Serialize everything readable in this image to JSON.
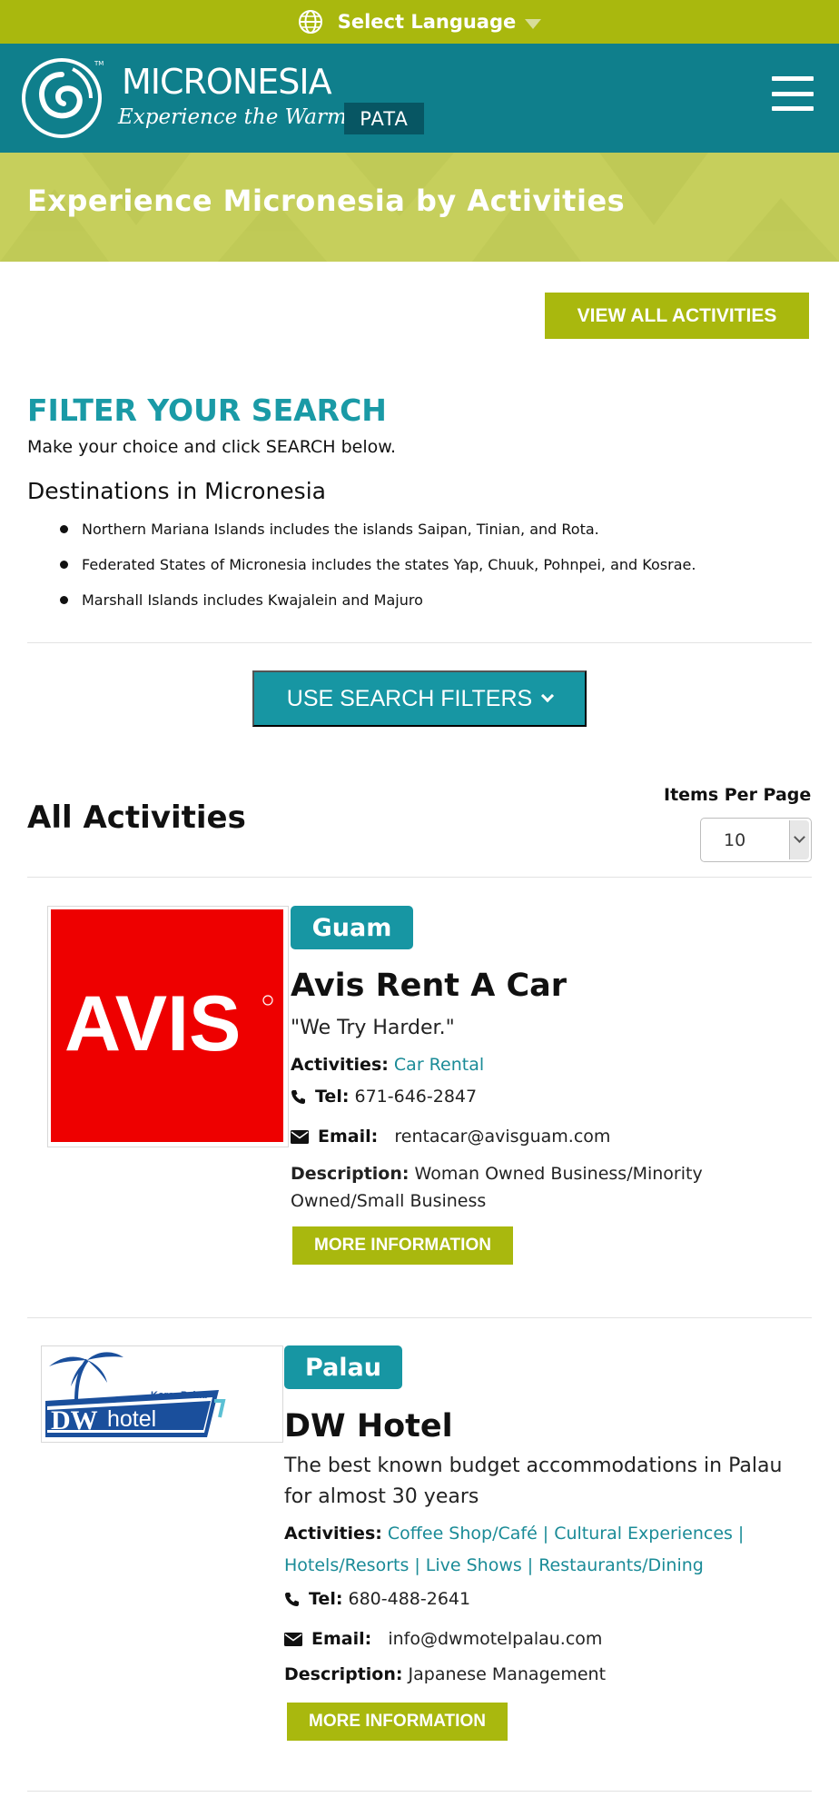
{
  "language_bar": {
    "label": "Select Language"
  },
  "header": {
    "brand": "MICRONESIA",
    "tagline": "Experience the Warmth",
    "partner": "PATA",
    "tm": "TM"
  },
  "banner": {
    "title": "Experience Micronesia by Activities"
  },
  "buttons": {
    "view_all": "VIEW ALL ACTIVITIES",
    "search_filters": "USE SEARCH FILTERS"
  },
  "filter": {
    "title": "FILTER YOUR SEARCH",
    "subtitle": "Make your choice and click SEARCH below.",
    "destinations_title": "Destinations in Micronesia",
    "destinations": [
      "Northern Mariana Islands includes the islands Saipan, Tinian, and Rota.",
      "Federated States of Micronesia includes the states Yap, Chuuk, Pohnpei, and Kosrae.",
      "Marshall Islands includes Kwajalein and Majuro"
    ]
  },
  "results": {
    "title": "All Activities",
    "items_per_page_label": "Items Per Page",
    "items_per_page_value": "10"
  },
  "labels": {
    "activities": "Activities:",
    "tel": "Tel:",
    "email": "Email:",
    "description": "Description:",
    "more": "MORE INFORMATION"
  },
  "listings": [
    {
      "location": "Guam",
      "name": "Avis Rent A Car",
      "slogan": "\"We Try Harder.\"",
      "activities": [
        "Car Rental"
      ],
      "tel": "671-646-2847",
      "email": "rentacar@avisguam.com",
      "description_line1": "Woman Owned Business/Minority",
      "description_line2": "Owned/Small Business",
      "logo_text": "AVIS",
      "logo_color": "#ee0000"
    },
    {
      "location": "Palau",
      "name": "DW Hotel",
      "slogan_line1": "The best known budget accommodations in Palau",
      "slogan_line2": "for almost 30 years",
      "activities": [
        "Coffee Shop/Café",
        "Cultural Experiences",
        "Hotels/Resorts",
        "Live Shows",
        "Restaurants/Dining"
      ],
      "tel": "680-488-2641",
      "email": "info@dwmotelpalau.com",
      "description": "Japanese Management",
      "logo_small": "Koror Palau",
      "logo_main": "DW",
      "logo_sub": "hotel"
    }
  ],
  "colors": {
    "olive": "#a9b80e",
    "teal": "#0f7f8c",
    "accent_teal": "#1796a3",
    "banner": "#c6cf5c"
  }
}
